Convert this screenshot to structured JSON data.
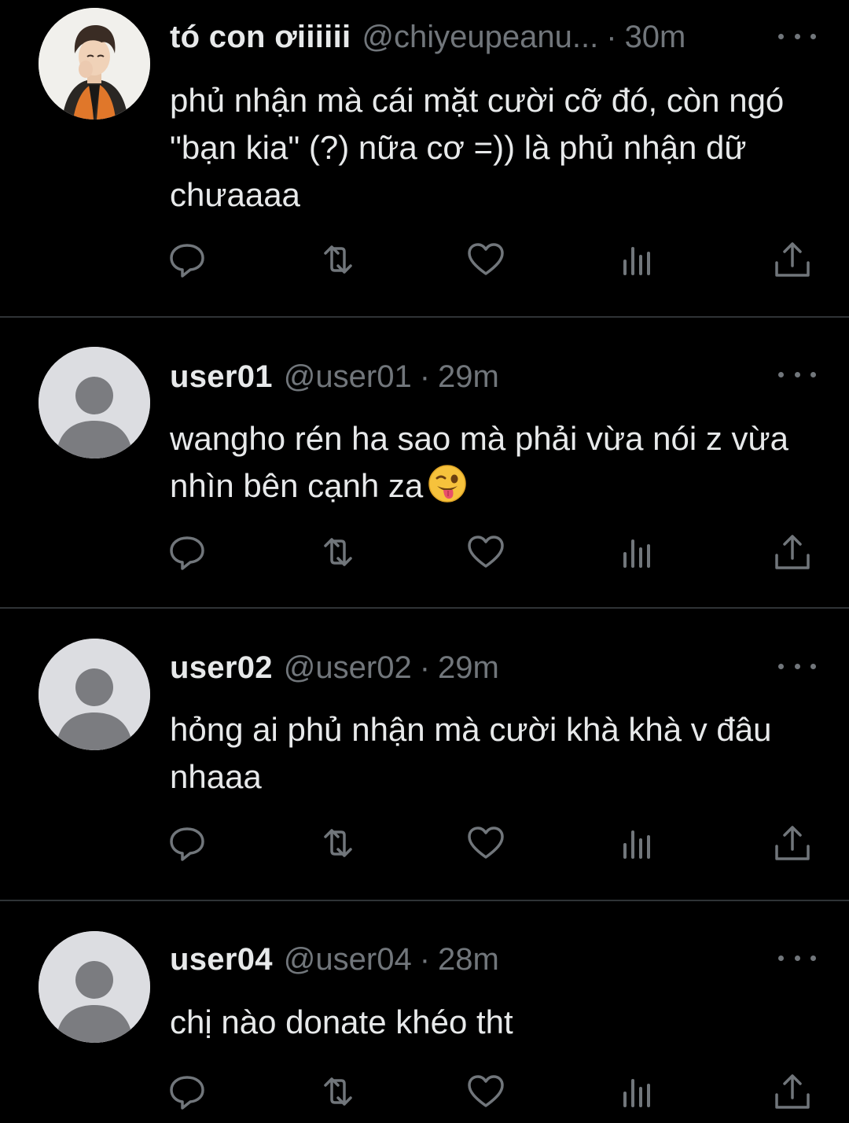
{
  "colors": {
    "background": "#000000",
    "text_primary": "#e7e9ea",
    "text_secondary": "#71767b",
    "divider": "#2f3336",
    "avatar_placeholder_bg": "#dcdde1",
    "avatar_placeholder_fg": "#7b7c80"
  },
  "tweets": [
    {
      "display_name": "tó con ơiiiiii",
      "handle": "@chiyeupeanu...",
      "separator": "·",
      "time": "30m",
      "text": "phủ nhận mà cái mặt cười cỡ đó, còn ngó \"bạn kia\" (?) nữa cơ =)) là phủ nhận dữ chưaaaa",
      "avatar": "photo",
      "actions": [
        "reply-icon",
        "retweet-icon",
        "like-icon",
        "analytics-icon",
        "share-icon"
      ]
    },
    {
      "display_name": "user01",
      "handle": "@user01",
      "separator": "·",
      "time": "29m",
      "text": "wangho rén ha sao mà phải vừa nói z vừa nhìn bên cạnh za",
      "emoji": "winking-face-with-tongue",
      "avatar": "default",
      "actions": [
        "reply-icon",
        "retweet-icon",
        "like-icon",
        "analytics-icon",
        "share-icon"
      ]
    },
    {
      "display_name": "user02",
      "handle": "@user02",
      "separator": "·",
      "time": "29m",
      "text": "hỏng ai phủ nhận mà cười khà khà v đâu nhaaa",
      "avatar": "default",
      "actions": [
        "reply-icon",
        "retweet-icon",
        "like-icon",
        "analytics-icon",
        "share-icon"
      ]
    },
    {
      "display_name": "user04",
      "handle": "@user04",
      "separator": "·",
      "time": "28m",
      "text": "chị nào donate khéo tht",
      "avatar": "default",
      "actions": [
        "reply-icon",
        "retweet-icon",
        "like-icon",
        "analytics-icon",
        "share-icon"
      ]
    }
  ]
}
